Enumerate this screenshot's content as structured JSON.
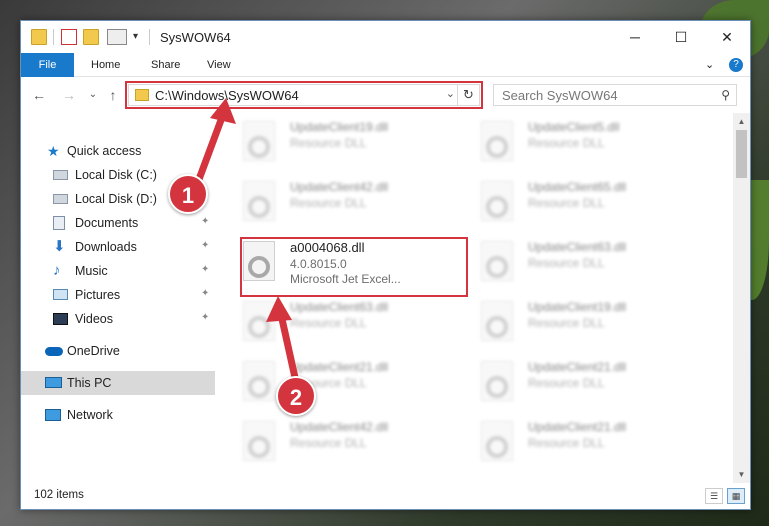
{
  "window": {
    "title": "SysWOW64",
    "minimize_glyph": "─",
    "maximize_glyph": "☐",
    "close_glyph": "✕"
  },
  "ribbon": {
    "tabs": [
      "File",
      "Home",
      "Share",
      "View"
    ],
    "expand_glyph": "⌄",
    "help_glyph": "?"
  },
  "address": {
    "path": "C:\\Windows\\SysWOW64",
    "dropdown_glyph": "⌄",
    "refresh_glyph": "↻",
    "back_glyph": "←",
    "forward_glyph": "→",
    "recent_glyph": "⌄",
    "up_glyph": "↑"
  },
  "search": {
    "placeholder": "Search SysWOW64",
    "icon": "search-icon",
    "glyph": "⚲"
  },
  "sidebar": {
    "items": [
      {
        "label": "Quick access",
        "icon": "star-icon",
        "pinned": false
      },
      {
        "label": "Local Disk (C:)",
        "icon": "drive-icon",
        "pinned": false
      },
      {
        "label": "Local Disk (D:)",
        "icon": "drive-icon",
        "pinned": false
      },
      {
        "label": "Documents",
        "icon": "documents-icon",
        "pinned": true
      },
      {
        "label": "Downloads",
        "icon": "downloads-icon",
        "pinned": true
      },
      {
        "label": "Music",
        "icon": "music-icon",
        "pinned": true
      },
      {
        "label": "Pictures",
        "icon": "pictures-icon",
        "pinned": true
      },
      {
        "label": "Videos",
        "icon": "videos-icon",
        "pinned": true
      },
      {
        "label": "OneDrive",
        "icon": "onedrive-icon",
        "pinned": false
      },
      {
        "label": "This PC",
        "icon": "this-pc-icon",
        "pinned": false,
        "selected": true
      },
      {
        "label": "Network",
        "icon": "network-icon",
        "pinned": false
      }
    ],
    "pin_glyph": "📌"
  },
  "files": {
    "highlighted": {
      "name": "a0004068.dll",
      "version": "4.0.8015.0",
      "description": "Microsoft Jet Excel..."
    },
    "left_column": [
      {
        "name": "UpdateClient19.dll",
        "type": "Resource DLL"
      },
      {
        "name": "UpdateClient42.dll",
        "type": "Resource DLL"
      },
      {
        "name": "UpdateClient63.dll",
        "type": "Resource DLL"
      },
      {
        "name": "UpdateClient21.dll",
        "type": "Resource DLL"
      },
      {
        "name": "UpdateClient42.dll",
        "type": "Resource DLL"
      }
    ],
    "right_column": [
      {
        "name": "UpdateClient5.dll",
        "type": "Resource DLL"
      },
      {
        "name": "UpdateClient65.dll",
        "type": "Resource DLL"
      },
      {
        "name": "UpdateClient63.dll",
        "type": "Resource DLL"
      },
      {
        "name": "UpdateClient19.dll",
        "type": "Resource DLL"
      },
      {
        "name": "UpdateClient21.dll",
        "type": "Resource DLL"
      },
      {
        "name": "UpdateClient21.dll",
        "type": "Resource DLL"
      }
    ]
  },
  "status": {
    "item_count": "102 items"
  },
  "callouts": [
    "1",
    "2"
  ],
  "colors": {
    "accent": "#1979ca",
    "highlight_red": "#d3343d",
    "selected_nav": "#d9d9d9"
  }
}
